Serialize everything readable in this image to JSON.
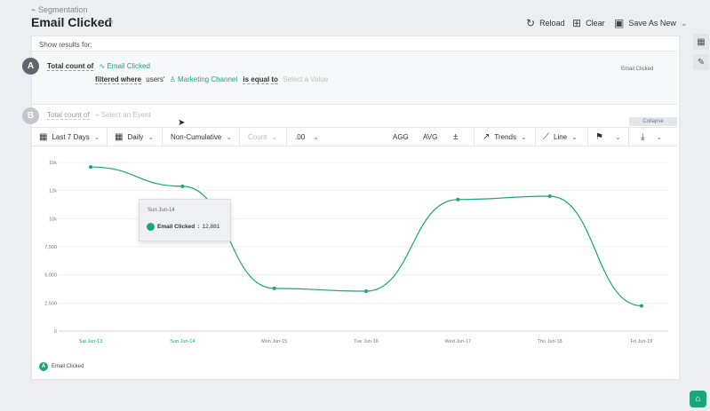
{
  "header": {
    "breadcrumb": "Segmentation",
    "title": "Email Clicked",
    "reload_label": "Reload",
    "clear_label": "Clear",
    "save_label": "Save As New"
  },
  "query": {
    "show_results_for": "Show results for:",
    "a": {
      "badge": "A",
      "total_count_of": "Total count of",
      "event": "Email Clicked",
      "filtered_where": "filtered where",
      "users": "users'",
      "property": "Marketing Channel",
      "operator": "is equal to",
      "value_placeholder": "Select a Value",
      "event_label_right": "Email Clicked"
    },
    "b": {
      "badge": "B",
      "total_count_of": "Total count of",
      "event_placeholder": "Select an Event"
    },
    "collapse_label": "Collapse"
  },
  "toolbar": {
    "date_range": "Last 7 Days",
    "interval": "Daily",
    "cumulative": "Non-Cumulative",
    "count": "Count",
    "decimals": ".00",
    "agg": "AGG",
    "avg": "AVG",
    "trends": "Trends",
    "chart_type": "Line"
  },
  "tooltip": {
    "date": "Sun Jun-14",
    "series": "Email Clicked",
    "value": "12,881"
  },
  "legend": {
    "badge": "A",
    "label": "Email Clicked"
  },
  "colors": {
    "accent": "#1ba57a",
    "badge_a": "#5f6470",
    "badge_b": "#c3c6cb"
  },
  "chart_data": {
    "type": "line",
    "categories": [
      "Sat Jun-13",
      "Sun Jun-14",
      "Mon Jun-15",
      "Tue Jun-16",
      "Wed Jun-17",
      "Thu Jun-18",
      "Fri Jun-19"
    ],
    "series": [
      {
        "name": "Email Clicked",
        "values": [
          14600,
          12881,
          3800,
          3550,
          11700,
          12000,
          2250
        ]
      }
    ],
    "yticks": [
      "0",
      "2,500",
      "5,000",
      "7,500",
      "10k",
      "12k",
      "15k"
    ],
    "ylim": [
      0,
      15000
    ],
    "highlight_categories": [
      "Sat Jun-13",
      "Sun Jun-14"
    ]
  }
}
